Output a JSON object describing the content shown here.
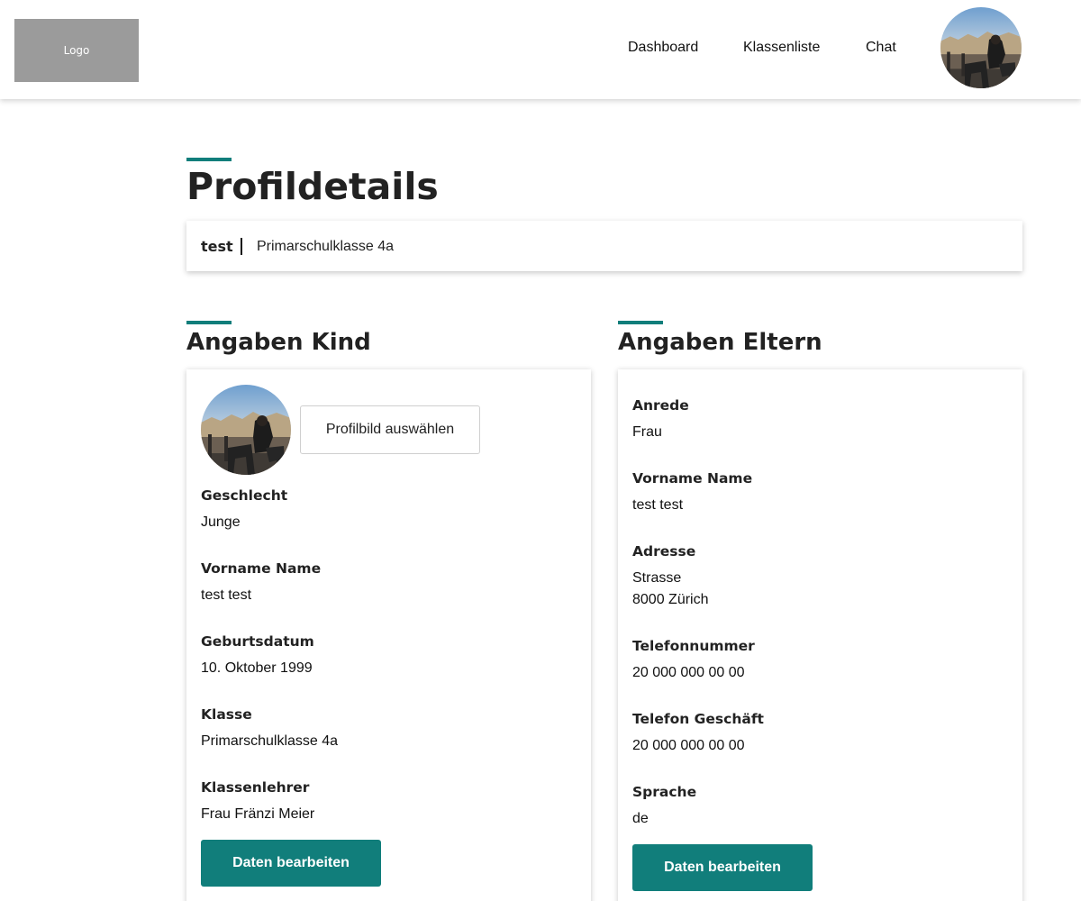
{
  "header": {
    "logo_text": "Logo",
    "nav": [
      "Dashboard",
      "Klassenliste",
      "Chat"
    ]
  },
  "page": {
    "title": "Profildetails",
    "summary": {
      "name": "test",
      "class": "Primarschulklasse 4a"
    }
  },
  "kind": {
    "heading": "Angaben Kind",
    "pick_image_label": "Profilbild auswählen",
    "fields": [
      {
        "label": "Geschlecht",
        "value": "Junge"
      },
      {
        "label": "Vorname Name",
        "value": "test test"
      },
      {
        "label": "Geburtsdatum",
        "value": "10. Oktober 1999"
      },
      {
        "label": "Klasse",
        "value": "Primarschulklasse 4a"
      },
      {
        "label": "Klassenlehrer",
        "value": "Frau Fränzi Meier"
      }
    ],
    "edit_label": "Daten bearbeiten"
  },
  "eltern": {
    "heading": "Angaben Eltern",
    "fields": [
      {
        "label": "Anrede",
        "value": "Frau"
      },
      {
        "label": "Vorname Name",
        "value": "test test"
      },
      {
        "label": "Adresse",
        "value": "Strasse",
        "value2": "8000 Zürich"
      },
      {
        "label": "Telefonnummer",
        "value": "20 000 000 00 00"
      },
      {
        "label": "Telefon Geschäft",
        "value": "20 000 000 00 00"
      },
      {
        "label": "Sprache",
        "value": "de"
      }
    ],
    "edit_label": "Daten bearbeiten"
  },
  "colors": {
    "accent": "#117e7b",
    "logo_bg": "#9b9b9b"
  },
  "icons": {
    "profile_avatar": "profile-photo"
  }
}
